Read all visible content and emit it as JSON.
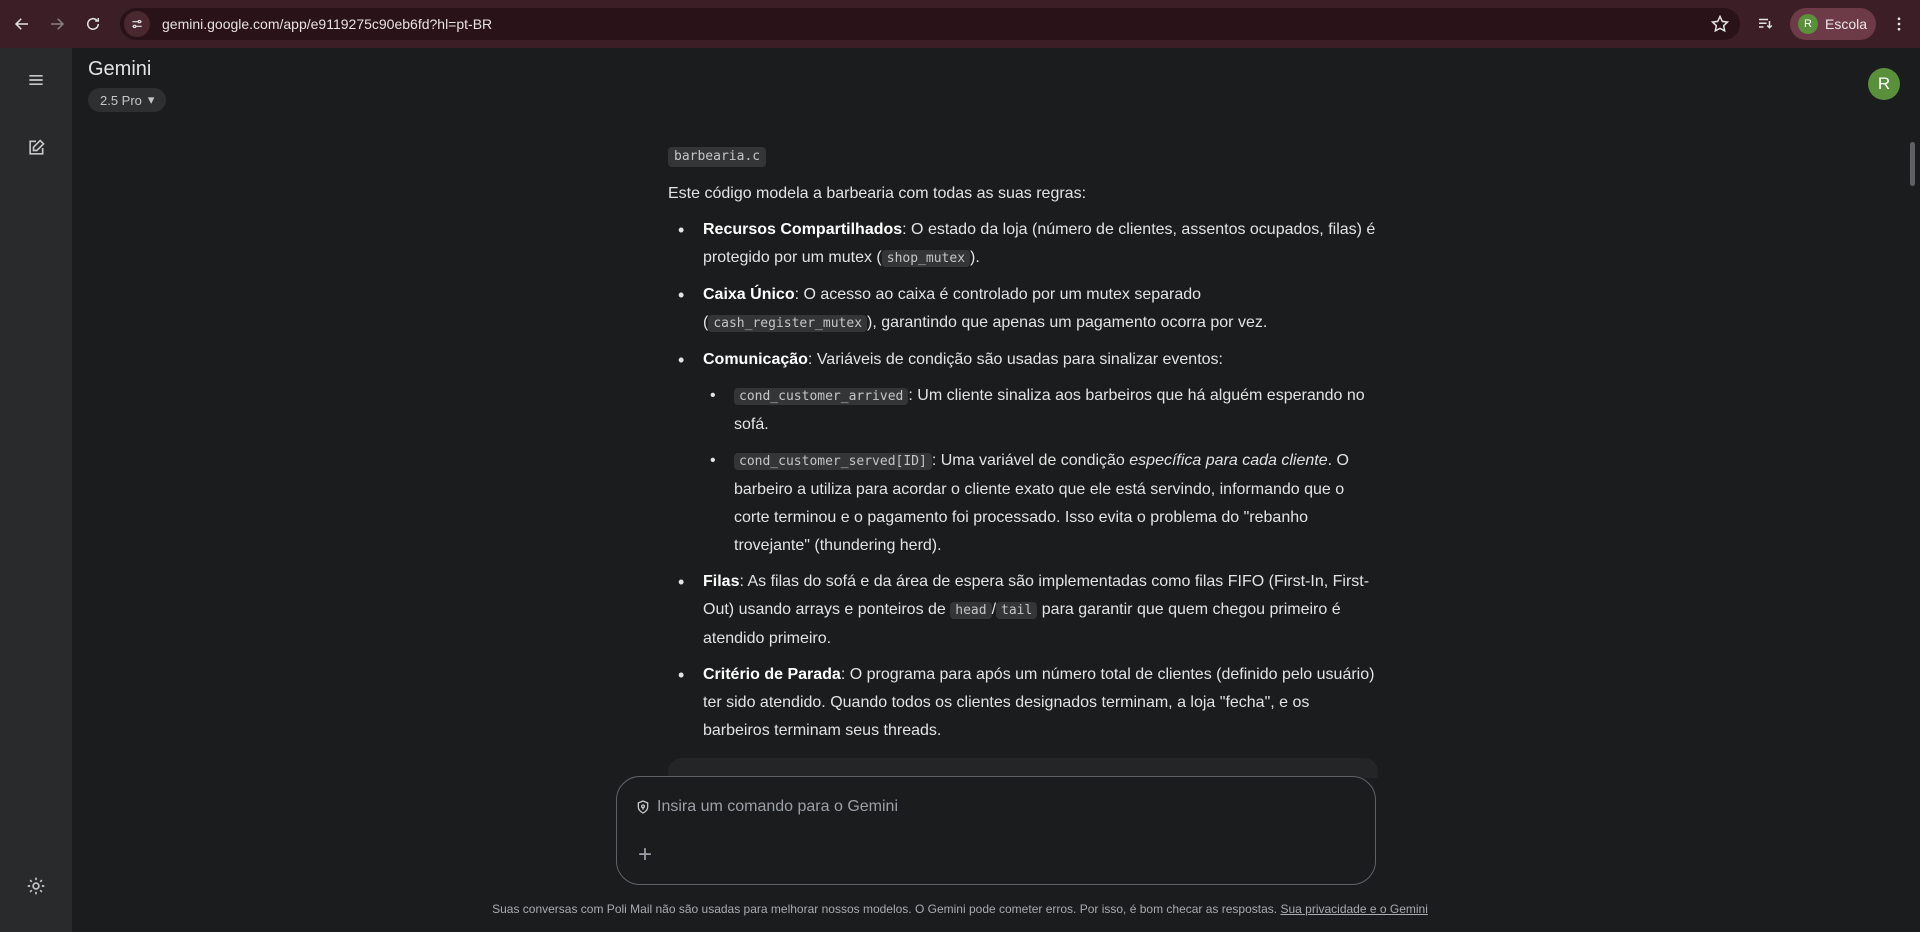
{
  "browser": {
    "url": "gemini.google.com/app/e9119275c90eb6fd?hl=pt-BR",
    "profile_initial": "R",
    "profile_name": "Escola"
  },
  "header": {
    "title": "Gemini",
    "model": "2.5 Pro",
    "avatar_initial": "R"
  },
  "content": {
    "file_name": "barbearia.c",
    "intro": "Este código modela a barbearia com todas as suas regras:",
    "items": [
      {
        "title": "Recursos Compartilhados",
        "text_before": ": O estado da loja (número de clientes, assentos ocupados, filas) é protegido por um mutex (",
        "code": "shop_mutex",
        "text_after": ")."
      },
      {
        "title": "Caixa Único",
        "text_before": ": O acesso ao caixa é controlado por um mutex separado (",
        "code": "cash_register_mutex",
        "text_after": "), garantindo que apenas um pagamento ocorra por vez."
      },
      {
        "title": "Comunicação",
        "text": ": Variáveis de condição são usadas para sinalizar eventos:",
        "subitems": [
          {
            "code": "cond_customer_arrived",
            "text": ": Um cliente sinaliza aos barbeiros que há alguém esperando no sofá."
          },
          {
            "code": "cond_customer_served[ID]",
            "text_before": ": Uma variável de condição ",
            "emphasis": "específica para cada cliente",
            "text_after": ". O barbeiro a utiliza para acordar o cliente exato que ele está servindo, informando que o corte terminou e o pagamento foi processado. Isso evita o problema do \"rebanho trovejante\" (thundering herd)."
          }
        ]
      },
      {
        "title": "Filas",
        "text_before": ": As filas do sofá e da área de espera são implementadas como filas FIFO (First-In, First-Out) usando arrays e ponteiros de ",
        "code1": "head",
        "sep": "/",
        "code2": "tail",
        "text_after": " para garantir que quem chegou primeiro é atendido primeiro."
      },
      {
        "title": "Critério de Parada",
        "text": ": O programa para após um número total de clientes (definido pelo usuário) ter sido atendido. Quando todos os clientes designados terminam, a loja \"fecha\", e os barbeiros terminam seus threads."
      }
    ]
  },
  "prompt": {
    "placeholder": "Insira um comando para o Gemini",
    "value": ""
  },
  "footer": {
    "text": "Suas conversas com Poli Mail não são usadas para melhorar nossos modelos. O Gemini pode cometer erros. Por isso, é bom checar as respostas. ",
    "link": "Sua privacidade e o Gemini"
  },
  "colors": {
    "browser_bar": "#3c1f26",
    "profile_chip": "#6d3a47",
    "avatar": "#5a8f3c",
    "background": "#1b1c1d",
    "rail": "#282a2c"
  },
  "icons": [
    "back-icon",
    "forward-icon",
    "reload-icon",
    "site-info-icon",
    "star-icon",
    "tab-search-icon",
    "kebab-icon",
    "menu-icon",
    "new-chat-icon",
    "settings-icon",
    "shield-icon",
    "plus-icon",
    "chevron-down-icon"
  ]
}
